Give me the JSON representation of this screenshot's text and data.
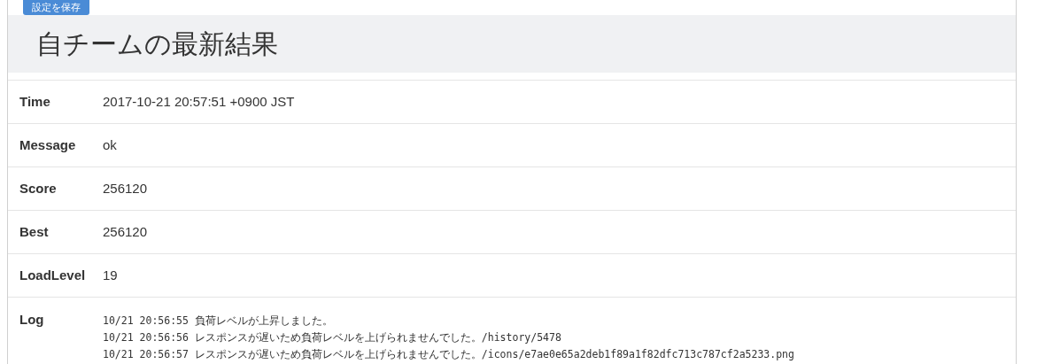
{
  "save_button": {
    "label": "設定を保存"
  },
  "panel": {
    "title": "自チームの最新結果"
  },
  "fields": [
    {
      "label": "Time",
      "value": "2017-10-21 20:57:51 +0900 JST"
    },
    {
      "label": "Message",
      "value": "ok"
    },
    {
      "label": "Score",
      "value": "256120"
    },
    {
      "label": "Best",
      "value": "256120"
    },
    {
      "label": "LoadLevel",
      "value": "19"
    }
  ],
  "log": {
    "label": "Log",
    "lines": [
      "10/21 20:56:55 負荷レベルが上昇しました。",
      "10/21 20:56:56 レスポンスが遅いため負荷レベルを上げられませんでした。/history/5478",
      "10/21 20:56:57 レスポンスが遅いため負荷レベルを上げられませんでした。/icons/e7ae0e65a2deb1f89a1f82dfc713c787cf2a5233.png"
    ]
  }
}
